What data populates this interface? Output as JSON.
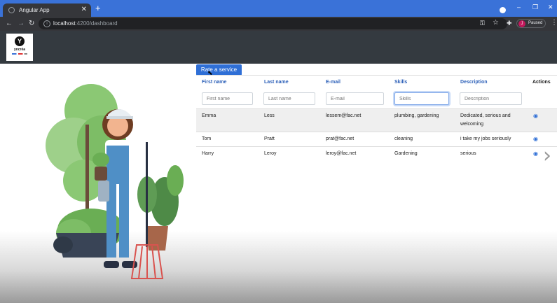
{
  "browser": {
    "tab_title": "Angular App",
    "close_glyph": "✕",
    "new_tab_glyph": "+",
    "url_host": "localhost",
    "url_path": ":4200/dashboard",
    "profile_initial": "J",
    "profile_status": "Paused",
    "window_controls": [
      "–",
      "❐",
      "✕"
    ]
  },
  "header": {
    "logo_letter": "Y",
    "logo_name": "yncréa"
  },
  "main": {
    "rate_button": "Rate a service",
    "columns": [
      "First name",
      "Last name",
      "E-mail",
      "Skills",
      "Description",
      "Actions"
    ],
    "filters": [
      {
        "placeholder": "First name",
        "value": ""
      },
      {
        "placeholder": "Last name",
        "value": ""
      },
      {
        "placeholder": "E-mail",
        "value": ""
      },
      {
        "placeholder": "Skills",
        "value": ""
      },
      {
        "placeholder": "Description",
        "value": ""
      }
    ],
    "rows": [
      {
        "first": "Emma",
        "last": "Less",
        "email": "lessem@fac.net",
        "skills": "plumbing, gardening",
        "desc1": "Dedicated, serious and",
        "desc2": "welcoming",
        "action_icon": "eye-icon"
      },
      {
        "first": "Tom",
        "last": "Pratt",
        "email": "prat@fac.net",
        "skills": "cleaning",
        "desc1": "i take my jobs seriously",
        "desc2": "",
        "action_icon": "eye-icon"
      },
      {
        "first": "Harry",
        "last": "Leroy",
        "email": "leroy@fac.net",
        "skills": "Gardening",
        "desc1": "serious",
        "desc2": "",
        "action_icon": "eye-icon"
      }
    ]
  },
  "colors": {
    "accent": "#2f6fd6",
    "header_bg": "#343a40",
    "tabstrip": "#3a72d8"
  }
}
